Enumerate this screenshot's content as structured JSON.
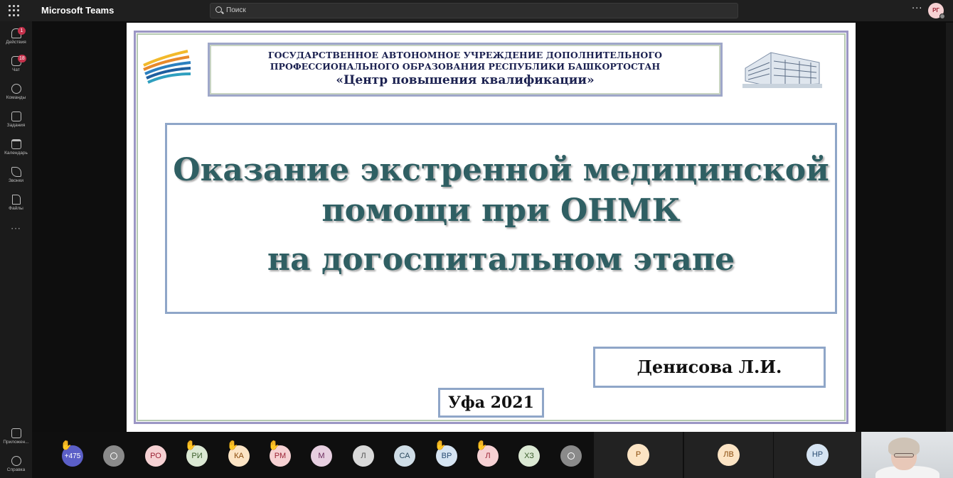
{
  "app": {
    "title": "Microsoft Teams"
  },
  "search": {
    "placeholder": "Поиск"
  },
  "header": {
    "more": "···",
    "user_initials": "РГ"
  },
  "rail": {
    "items": [
      {
        "label": "Действия",
        "icon": "bell-icon",
        "badge": "1"
      },
      {
        "label": "Чат",
        "icon": "chat-icon",
        "badge": "18"
      },
      {
        "label": "Команды",
        "icon": "teams-icon"
      },
      {
        "label": "Задания",
        "icon": "assignments-icon"
      },
      {
        "label": "Календарь",
        "icon": "calendar-icon"
      },
      {
        "label": "Звонки",
        "icon": "phone-icon"
      },
      {
        "label": "Файлы",
        "icon": "files-icon"
      }
    ],
    "more": "···",
    "apps_label": "Приложен...",
    "help_label": "Справка"
  },
  "slide": {
    "org_line1": "ГОСУДАРСТВЕННОЕ АВТОНОМНОЕ УЧРЕЖДЕНИЕ ДОПОЛНИТЕЛЬНОГО",
    "org_line2": "ПРОФЕССИОНАЛЬНОГО ОБРАЗОВАНИЯ РЕСПУБЛИКИ БАШКОРТОСТАН",
    "org_line3": "«Центр повышения квалификации»",
    "title_line1": "Оказание экстренной медицинской",
    "title_line2": "помощи при ОНМК",
    "title_line3": "на догоспитальном этапе",
    "author": "Денисова Л.И.",
    "city_year": "Уфа  2021",
    "colors": {
      "title": "#2f5f63",
      "frame": "#8fa6c8"
    }
  },
  "participants": [
    {
      "initials": "+475",
      "hand": true,
      "bg": "#5b5fc7",
      "fg": "#ffffff"
    },
    {
      "initials": "",
      "hand": false,
      "bg": "#8a8a8a",
      "fg": "#ffffff",
      "icon": "person-icon"
    },
    {
      "initials": "РО",
      "hand": false,
      "bg": "#f6d1d3",
      "fg": "#9b2335"
    },
    {
      "initials": "РИ",
      "hand": true,
      "bg": "#dbe8d3",
      "fg": "#3b5e2c"
    },
    {
      "initials": "КА",
      "hand": true,
      "bg": "#fce4c4",
      "fg": "#8a4b0c"
    },
    {
      "initials": "РМ",
      "hand": true,
      "bg": "#f6d1d3",
      "fg": "#9b2335"
    },
    {
      "initials": "М",
      "hand": false,
      "bg": "#e7cfe0",
      "fg": "#6b2a5c"
    },
    {
      "initials": "Л",
      "hand": false,
      "bg": "#d9d9d9",
      "fg": "#555555"
    },
    {
      "initials": "СА",
      "hand": false,
      "bg": "#cfdde6",
      "fg": "#2c4a5e"
    },
    {
      "initials": "ВР",
      "hand": true,
      "bg": "#d6e4f2",
      "fg": "#2a4d73"
    },
    {
      "initials": "Л",
      "hand": true,
      "bg": "#f6d1d3",
      "fg": "#9b2335"
    },
    {
      "initials": "ХЗ",
      "hand": false,
      "bg": "#dbe8d3",
      "fg": "#3b5e2c"
    },
    {
      "initials": "",
      "hand": false,
      "bg": "#8a8a8a",
      "fg": "#ffffff",
      "icon": "person-icon"
    }
  ],
  "tiles": [
    {
      "initials": "Р",
      "bg": "#fce4c4",
      "fg": "#8a4b0c"
    },
    {
      "initials": "ЛВ",
      "bg": "#fce4c4",
      "fg": "#8a4b0c"
    },
    {
      "initials": "НР",
      "bg": "#d6e4f2",
      "fg": "#2a4d73"
    }
  ]
}
